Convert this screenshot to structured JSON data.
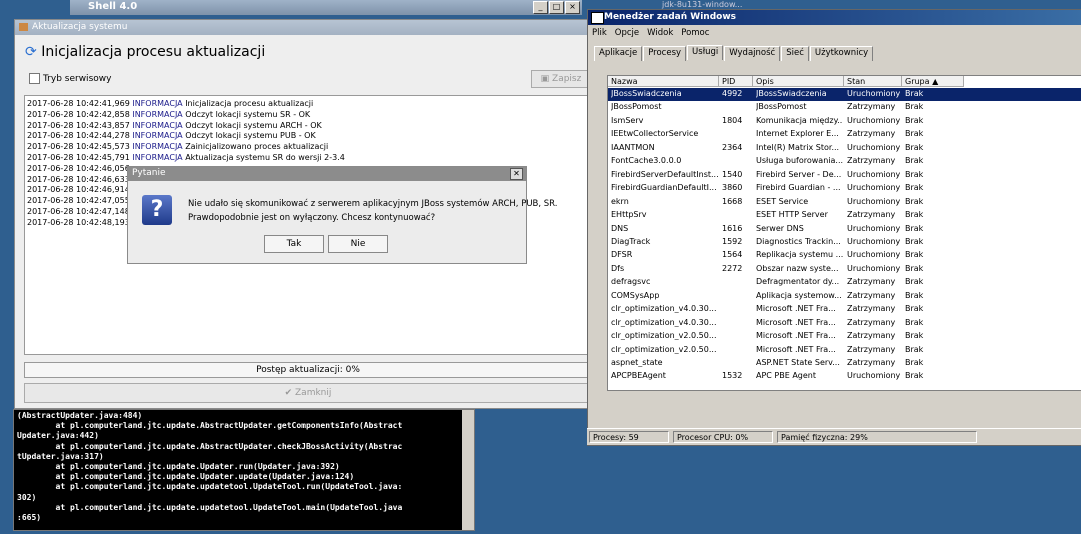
{
  "shell": {
    "title": "Shell 4.0"
  },
  "taskbar_hint": "jdk-8u131-window...",
  "update_window": {
    "title": "Aktualizacja systemu",
    "heading": "Inicjalizacja procesu aktualizacji",
    "service_mode_label": "Tryb serwisowy",
    "save_label": "Zapisz",
    "log": [
      {
        "ts": "2017-06-28 10:42:41,969",
        "level": "INFORMACJA",
        "msg": "Inicjalizacja procesu aktualizacji"
      },
      {
        "ts": "2017-06-28 10:42:42,858",
        "level": "INFORMACJA",
        "msg": "Odczyt lokacji systemu SR - OK"
      },
      {
        "ts": "2017-06-28 10:42:43,857",
        "level": "INFORMACJA",
        "msg": "Odczyt lokacji systemu ARCH - OK"
      },
      {
        "ts": "2017-06-28 10:42:44,278",
        "level": "INFORMACJA",
        "msg": "Odczyt lokacji systemu PUB - OK"
      },
      {
        "ts": "2017-06-28 10:42:45,573",
        "level": "INFORMACJA",
        "msg": "Zainicjalizowano proces aktualizacji"
      },
      {
        "ts": "2017-06-28 10:42:45,791",
        "level": "INFORMACJA",
        "msg": "Aktualizacja systemu SR do wersji 2-3.4"
      },
      {
        "ts": "2017-06-28 10:42:46,056",
        "level": "",
        "msg": ""
      },
      {
        "ts": "2017-06-28 10:42:46,633",
        "level": "",
        "msg": ""
      },
      {
        "ts": "2017-06-28 10:42:46,914",
        "level": "",
        "msg": ""
      },
      {
        "ts": "2017-06-28 10:42:47,055",
        "level": "",
        "msg": ""
      },
      {
        "ts": "2017-06-28 10:42:47,148",
        "level": "",
        "msg": ""
      },
      {
        "ts": "2017-06-28 10:42:48,193",
        "level": "",
        "msg": ""
      }
    ],
    "progress_label": "Postęp aktualizacji: 0%",
    "progress": 0,
    "close_label": "Zamknij"
  },
  "dialog": {
    "title": "Pytanie",
    "line1": "Nie udało się skomunikować z serwerem aplikacyjnym JBoss systemów ARCH, PUB, SR.",
    "line2": "Prawdopodobnie jest on wyłączony. Chcesz kontynuować?",
    "yes_label": "Tak",
    "no_label": "Nie"
  },
  "console": {
    "lines": [
      "(AbstractUpdater.java:484)",
      "        at pl.computerland.jtc.update.AbstractUpdater.getComponentsInfo(Abstract",
      "Updater.java:442)",
      "        at pl.computerland.jtc.update.AbstractUpdater.checkJBossActivity(Abstrac",
      "tUpdater.java:317)",
      "        at pl.computerland.jtc.update.Updater.run(Updater.java:392)",
      "        at pl.computerland.jtc.update.Updater.update(Updater.java:124)",
      "        at pl.computerland.jtc.update.updatetool.UpdateTool.run(UpdateTool.java:",
      "302)",
      "        at pl.computerland.jtc.update.updatetool.UpdateTool.main(UpdateTool.java",
      ":665)"
    ]
  },
  "taskmgr": {
    "title": "Menedżer zadań Windows",
    "menu": [
      "Plik",
      "Opcje",
      "Widok",
      "Pomoc"
    ],
    "tabs": [
      "Aplikacje",
      "Procesy",
      "Usługi",
      "Wydajność",
      "Sieć",
      "Użytkownicy"
    ],
    "active_tab": 2,
    "columns": [
      "Nazwa",
      "PID",
      "Opis",
      "Stan",
      "Grupa"
    ],
    "rows": [
      [
        "JBossSwiadczenia",
        "4992",
        "JBossSwiadczenia",
        "Uruchomiony",
        "Brak"
      ],
      [
        "JBossPomost",
        "",
        "JBossPomost",
        "Zatrzymany",
        "Brak"
      ],
      [
        "IsmServ",
        "1804",
        "Komunikacja między...",
        "Uruchomiony",
        "Brak"
      ],
      [
        "IEEtwCollectorService",
        "",
        "Internet Explorer E...",
        "Zatrzymany",
        "Brak"
      ],
      [
        "IAANTMON",
        "2364",
        "Intel(R) Matrix Stor...",
        "Uruchomiony",
        "Brak"
      ],
      [
        "FontCache3.0.0.0",
        "",
        "Usługa buforowania...",
        "Zatrzymany",
        "Brak"
      ],
      [
        "FirebirdServerDefaultInst...",
        "1540",
        "Firebird Server - De...",
        "Uruchomiony",
        "Brak"
      ],
      [
        "FirebirdGuardianDefaultI...",
        "3860",
        "Firebird Guardian - ...",
        "Uruchomiony",
        "Brak"
      ],
      [
        "ekrn",
        "1668",
        "ESET Service",
        "Uruchomiony",
        "Brak"
      ],
      [
        "EHttpSrv",
        "",
        "ESET HTTP Server",
        "Zatrzymany",
        "Brak"
      ],
      [
        "DNS",
        "1616",
        "Serwer DNS",
        "Uruchomiony",
        "Brak"
      ],
      [
        "DiagTrack",
        "1592",
        "Diagnostics Trackin...",
        "Uruchomiony",
        "Brak"
      ],
      [
        "DFSR",
        "1564",
        "Replikacja systemu ...",
        "Uruchomiony",
        "Brak"
      ],
      [
        "Dfs",
        "2272",
        "Obszar nazw syste...",
        "Uruchomiony",
        "Brak"
      ],
      [
        "defragsvc",
        "",
        "Defragmentator dy...",
        "Zatrzymany",
        "Brak"
      ],
      [
        "COMSysApp",
        "",
        "Aplikacja systemow...",
        "Zatrzymany",
        "Brak"
      ],
      [
        "clr_optimization_v4.0.30...",
        "",
        "Microsoft .NET Fra...",
        "Zatrzymany",
        "Brak"
      ],
      [
        "clr_optimization_v4.0.30...",
        "",
        "Microsoft .NET Fra...",
        "Zatrzymany",
        "Brak"
      ],
      [
        "clr_optimization_v2.0.50...",
        "",
        "Microsoft .NET Fra...",
        "Zatrzymany",
        "Brak"
      ],
      [
        "clr_optimization_v2.0.50...",
        "",
        "Microsoft .NET Fra...",
        "Zatrzymany",
        "Brak"
      ],
      [
        "aspnet_state",
        "",
        "ASP.NET State Serv...",
        "Zatrzymany",
        "Brak"
      ],
      [
        "APCPBEAgent",
        "1532",
        "APC PBE Agent",
        "Uruchomiony",
        "Brak"
      ]
    ],
    "status": {
      "processes": "Procesy: 59",
      "cpu": "Procesor CPU: 0%",
      "memory": "Pamięć fizyczna: 29%"
    }
  }
}
